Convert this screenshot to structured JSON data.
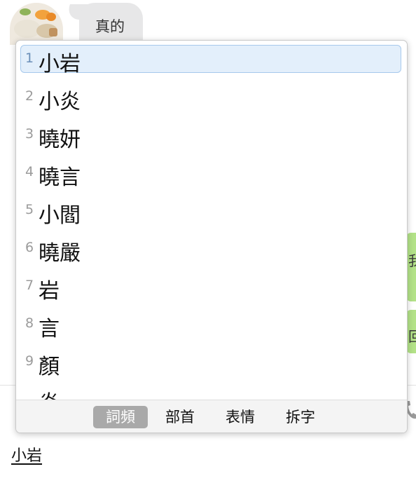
{
  "chat": {
    "bubble_text": "真的",
    "right_peek_1": "我",
    "right_peek_2": "回"
  },
  "candidates": [
    {
      "number": "1",
      "text": "小岩",
      "selected": true
    },
    {
      "number": "2",
      "text": "小炎"
    },
    {
      "number": "3",
      "text": "曉妍"
    },
    {
      "number": "4",
      "text": "曉言"
    },
    {
      "number": "5",
      "text": "小閻"
    },
    {
      "number": "6",
      "text": "曉嚴"
    },
    {
      "number": "7",
      "text": "岩"
    },
    {
      "number": "8",
      "text": "言"
    },
    {
      "number": "9",
      "text": "顏"
    },
    {
      "number": "",
      "text": "炎"
    }
  ],
  "tabs": [
    {
      "label": "詞頻",
      "active": true
    },
    {
      "label": "部首"
    },
    {
      "label": "表情"
    },
    {
      "label": "拆字"
    }
  ],
  "input": {
    "composing_text": "小岩"
  },
  "colors": {
    "selection_bg": "#e3effb",
    "selection_border": "#a7c9ec",
    "bubble_gray": "#e7e7e8",
    "bubble_green": "#b3e288",
    "active_tab": "#a9a9a9"
  }
}
